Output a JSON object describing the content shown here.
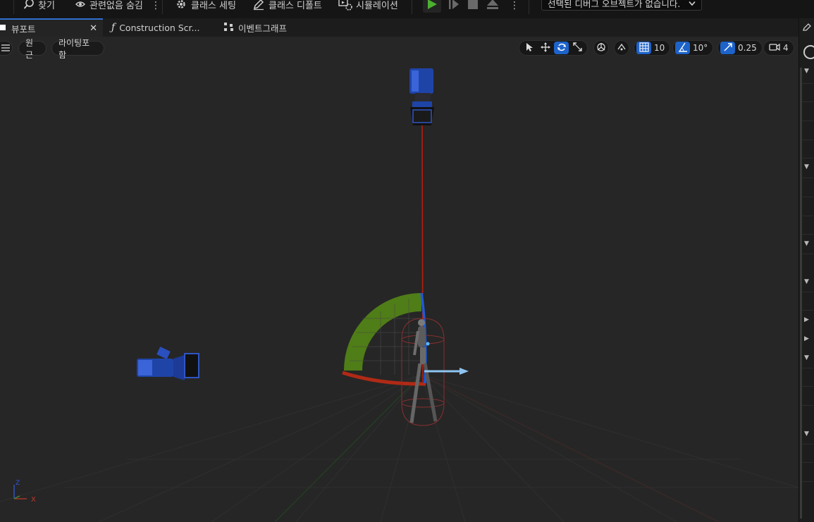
{
  "toolbar": {
    "find_label": "찾기",
    "hide_unrelated_label": "관련없음 숨김",
    "class_settings_label": "클래스 세팅",
    "class_defaults_label": "클래스 디폴트",
    "simulation_label": "시뮬레이션",
    "debug_object_label": "선택된 디버그 오브젝트가 없습니다."
  },
  "tabs": [
    {
      "label": "뷰포트"
    },
    {
      "label": "Construction Scr..."
    },
    {
      "label": "이벤트그래프"
    }
  ],
  "viewport": {
    "view_mode_label": "원근",
    "lighting_label": "라이팅포함",
    "grid_snap_value": "10",
    "rotation_snap_value": "10°",
    "scale_snap_value": "0.25",
    "camera_speed_value": "4"
  },
  "colors": {
    "accent": "#1d63c9",
    "play_green": "#4caf2f",
    "gizmo_green": "#4f7d17",
    "gizmo_red": "#b02a16",
    "gizmo_blue": "#1f5ad8"
  }
}
